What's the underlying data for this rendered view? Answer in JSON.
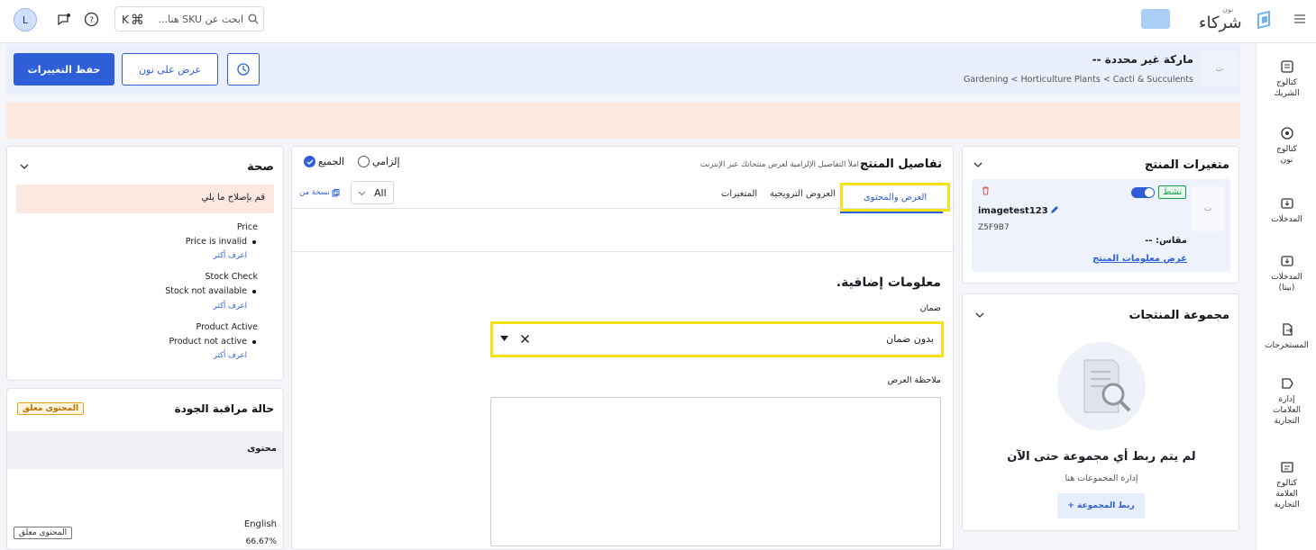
{
  "topbar": {
    "brand_small": "نون",
    "brand": "شركاء",
    "search_placeholder": "ابحث عن SKU هنا...",
    "shortcut_key": "K",
    "avatar_initial": "L"
  },
  "sidebar": {
    "items": [
      {
        "label": "كتالوج الشريك",
        "icon": "catalog-partner-icon"
      },
      {
        "label": "كتالوج نون",
        "icon": "catalog-noon-icon"
      },
      {
        "label": "المدخلات",
        "icon": "inbox-icon"
      },
      {
        "label": "المدخلات (بيتا)",
        "icon": "inbox-beta-icon"
      },
      {
        "label": "المستخرجات",
        "icon": "export-icon"
      },
      {
        "label": "إدارة العلامات التجارية",
        "icon": "brand-management-icon"
      },
      {
        "label": "كتالوج العلامة التجارية",
        "icon": "brand-catalog-icon"
      }
    ]
  },
  "header": {
    "brand": "ماركة غير محددة --",
    "breadcrumb": "Gardening < Horticulture Plants < Cacti & Succulents",
    "image_placeholder": "ت",
    "save_label": "حفظ التغييرات",
    "view_label": "عرض على نون"
  },
  "variants": {
    "title": "متغيرات المنتج",
    "status": "نشط",
    "name": "imagetest123",
    "sku": "Z5F9B7",
    "size_label": "مقاس: --",
    "view_info": "عرض معلومات المنتج",
    "image_placeholder": "ت"
  },
  "group": {
    "title": "مجموعة المنتجات",
    "empty_title": "لم يتم ربط أي مجموعة حتى الآن",
    "empty_sub": "إدارة المجموعات هنا",
    "link_button": "+ ربط المجموعة"
  },
  "details": {
    "title": "تفاصيل المنتج",
    "subtitle": "املأ التفاصيل الإلزامية لعرض منتجاتك عبر الإنترنت",
    "filter_required": "إلزامي",
    "filter_all": "الجميع",
    "tabs": [
      "العرض والمحتوى",
      "العروض الترويجية",
      "المتغيرات"
    ],
    "select_value": "All",
    "copy_from": "نسخة من",
    "section_title": "معلومات إضافية.",
    "warranty_label": "ضمان",
    "warranty_value": "بدون ضمان",
    "offer_note_label": "ملاحظة العرض"
  },
  "health": {
    "title": "صحة",
    "banner": "قم بإصلاح ما يلي",
    "issues": [
      {
        "title": "Price",
        "detail": "Price is invalid",
        "link": "اعرف أكثر"
      },
      {
        "title": "Stock Check",
        "detail": "Stock not available",
        "link": "اعرف أكثر"
      },
      {
        "title": "Product Active",
        "detail": "Product not active",
        "link": "اعرف أكثر"
      }
    ]
  },
  "qc": {
    "title": "حالة مراقبة الجودة",
    "badge": "المحتوى معلق",
    "section": "محتوى",
    "language": "English",
    "percent": "66.67%",
    "row_badge": "المحتوى معلق"
  },
  "colors": {
    "primary": "#2f5fd8",
    "highlight": "#f3e316",
    "status_green": "#1a9b4b",
    "alert_bg": "#fde7e1"
  }
}
